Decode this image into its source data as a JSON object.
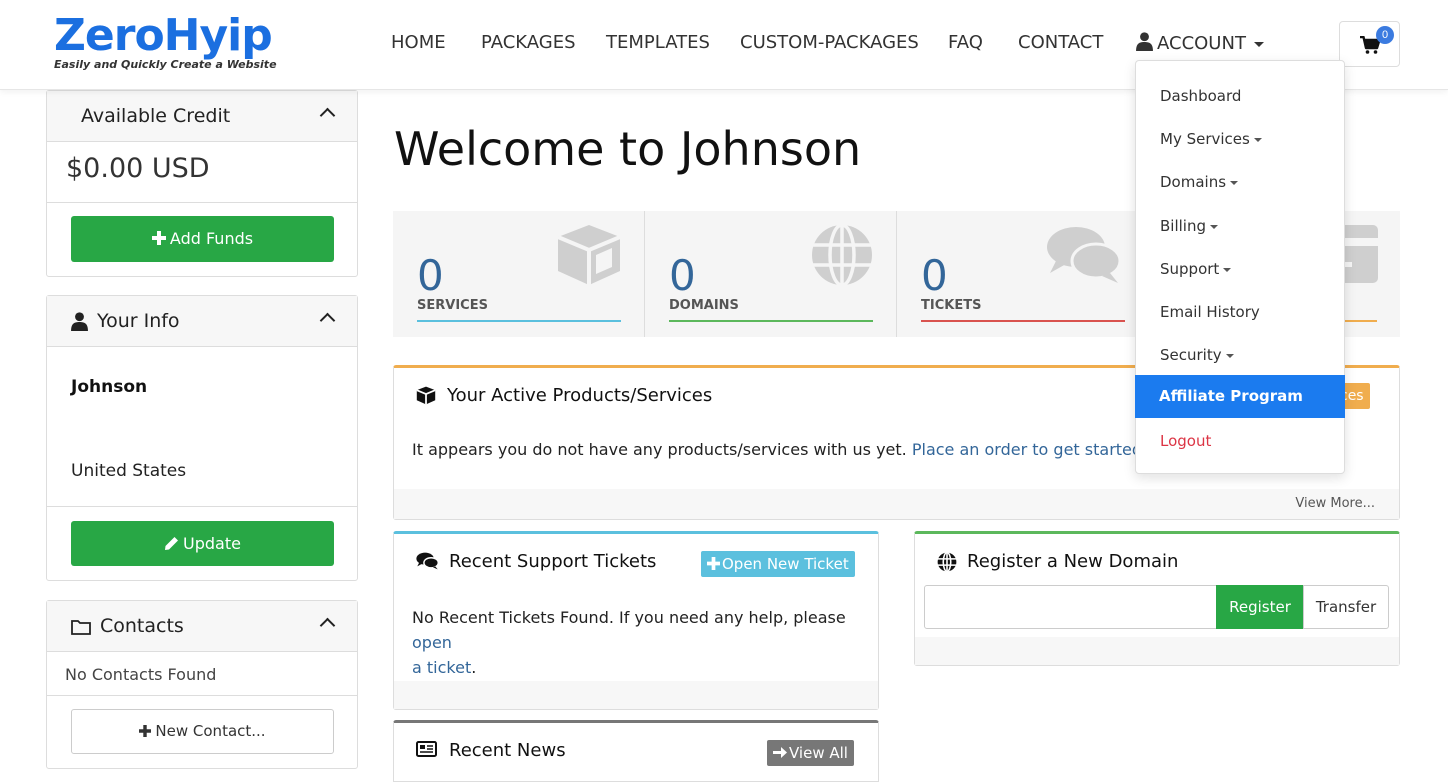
{
  "brand": {
    "name": "ZeroHyip",
    "tagline": "Easily and Quickly Create a Website"
  },
  "nav": [
    {
      "label": "HOME"
    },
    {
      "label": "PACKAGES"
    },
    {
      "label": "TEMPLATES"
    },
    {
      "label": "CUSTOM-PACKAGES"
    },
    {
      "label": "FAQ"
    },
    {
      "label": "CONTACT"
    },
    {
      "label": "ACCOUNT"
    }
  ],
  "cart": {
    "count": "0"
  },
  "account_menu": [
    {
      "label": "Dashboard"
    },
    {
      "label": "My Services"
    },
    {
      "label": "Domains"
    },
    {
      "label": "Billing"
    },
    {
      "label": "Support"
    },
    {
      "label": "Email History"
    },
    {
      "label": "Security"
    },
    {
      "label": "Affiliate Program"
    },
    {
      "label": "Logout"
    }
  ],
  "sidebar": {
    "credit": {
      "title": "Available Credit",
      "amount": "$0.00 USD",
      "button": "Add Funds"
    },
    "info": {
      "title": "Your Info",
      "name": "Johnson",
      "country": "United States",
      "button": "Update"
    },
    "contacts": {
      "title": "Contacts",
      "empty": "No Contacts Found",
      "button": "New Contact..."
    }
  },
  "main": {
    "welcome": "Welcome to Johnson",
    "stats": [
      {
        "value": "0",
        "label": "SERVICES",
        "color": "#5bc0de"
      },
      {
        "value": "0",
        "label": "DOMAINS",
        "color": "#5cb85c"
      },
      {
        "value": "0",
        "label": "TICKETS",
        "color": "#d9534f"
      },
      {
        "value": "",
        "label": "",
        "color": "#f0ad4e"
      }
    ],
    "products": {
      "title": "Your Active Products/Services",
      "button_fragment": "ces",
      "text": "It appears you do not have any products/services with us yet.",
      "link": "Place an order to get started",
      "period": ".",
      "view_more": "View More..."
    },
    "tickets": {
      "title": "Recent Support Tickets",
      "button": "Open New Ticket",
      "text": "No Recent Tickets Found. If you need any help, please",
      "link1": "open",
      "link2": "a ticket",
      "period": "."
    },
    "domain": {
      "title": "Register a New Domain",
      "register": "Register",
      "transfer": "Transfer"
    },
    "news": {
      "title": "Recent News",
      "button": "View All"
    }
  }
}
